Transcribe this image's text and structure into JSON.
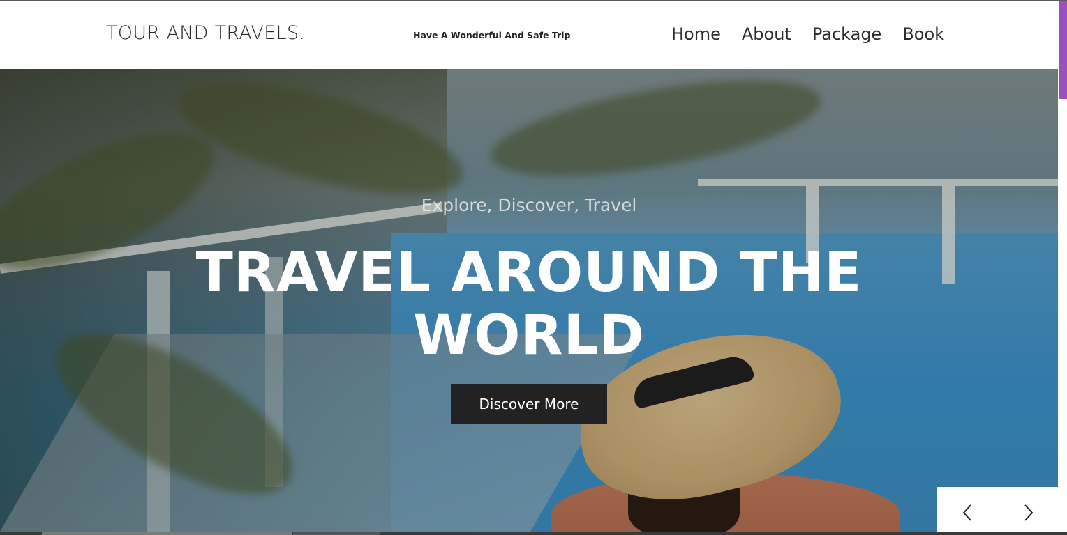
{
  "header": {
    "logo": "TOUR AND TRAVELS.",
    "tagline": "Have A Wonderful And Safe Trip",
    "nav": [
      "Home",
      "About",
      "Package",
      "Book"
    ]
  },
  "hero": {
    "eyebrow": "Explore, Discover, Travel",
    "headline": "TRAVEL AROUND THE WORLD",
    "cta_label": "Discover More"
  },
  "slider": {
    "prev_icon": "chevron-left-icon",
    "next_icon": "chevron-right-icon"
  },
  "colors": {
    "accent_scroll": "#9b4fc0",
    "cta_bg": "#222222",
    "text_dark": "#2a2a2a"
  }
}
